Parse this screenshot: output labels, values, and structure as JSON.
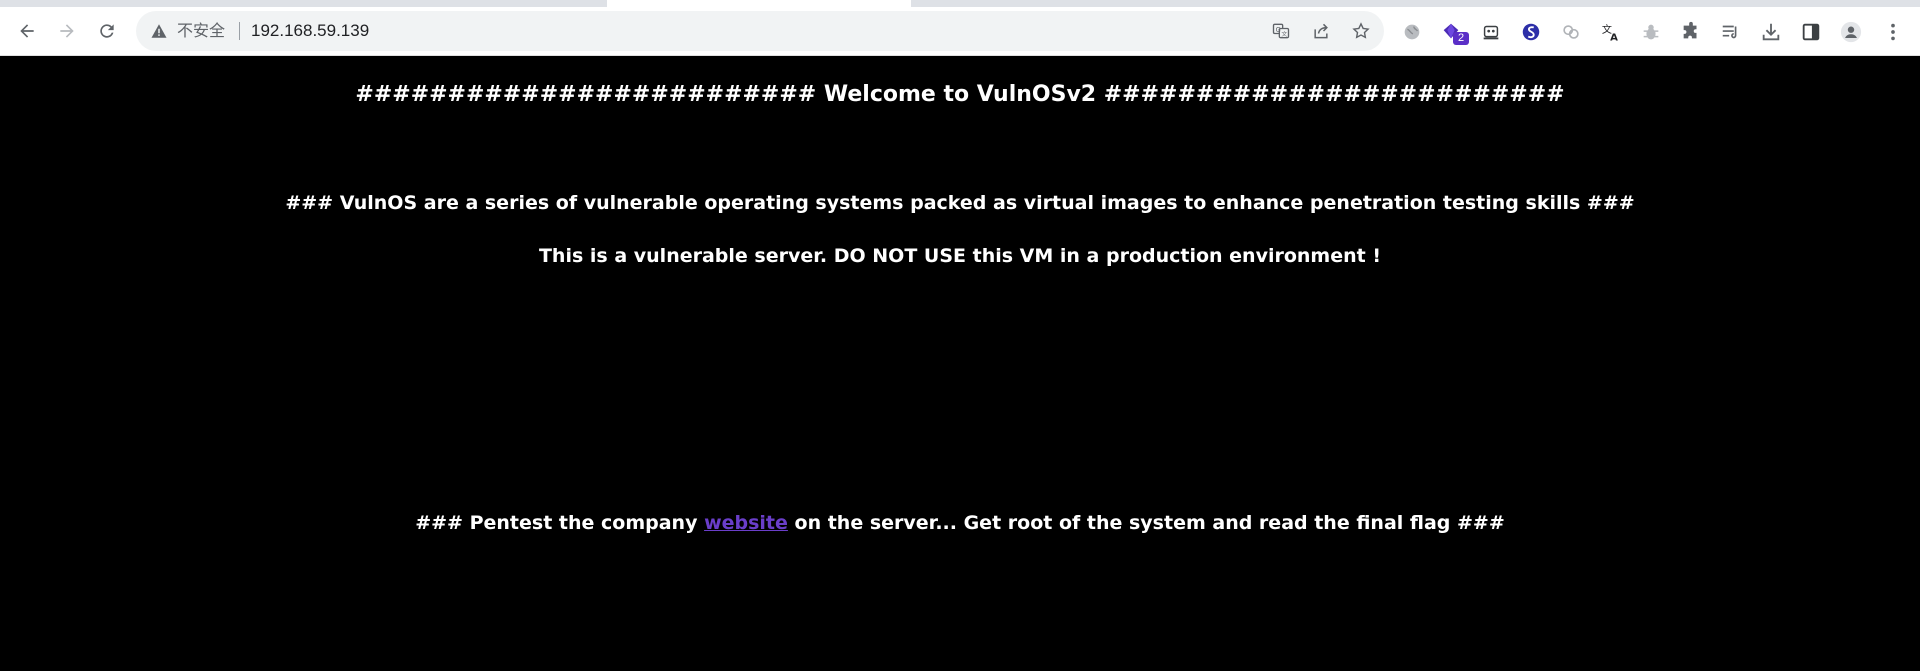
{
  "browser": {
    "security_label": "不安全",
    "url": "192.168.59.139",
    "extension_badge": "2",
    "colors": {
      "toolbar_bg": "#ffffff",
      "omnibox_bg": "#f1f3f4",
      "badge_bg": "#5b2fc7"
    },
    "toolbar_icons": [
      "back-arrow-icon",
      "forward-arrow-icon",
      "reload-icon",
      "warning-icon",
      "translate-page-icon",
      "share-icon",
      "bookmark-star-icon"
    ],
    "extension_icons": [
      "globe-icon",
      "diamond-extension-icon",
      "robot-extension-icon",
      "s-logo-extension-icon",
      "link-extension-icon",
      "translate-extension-icon",
      "bug-extension-icon",
      "puzzle-extensions-icon",
      "reading-list-icon",
      "downloads-icon",
      "side-panel-icon",
      "profile-avatar-icon",
      "more-menu-icon"
    ]
  },
  "page": {
    "title": "######################### Welcome to VulnOSv2 #########################",
    "line2": "### VulnOS are a series of vulnerable operating systems packed as virtual images to enhance penetration testing skills ###",
    "line3": "This is a vulnerable server. DO NOT USE this VM in a production environment !",
    "line4_prefix": "### Pentest the company ",
    "line4_link": "website",
    "line4_suffix": " on the server... Get root of the system and read the final flag ###",
    "colors": {
      "background": "#000000",
      "text": "#ffffff",
      "link": "#6a3ec9"
    }
  }
}
